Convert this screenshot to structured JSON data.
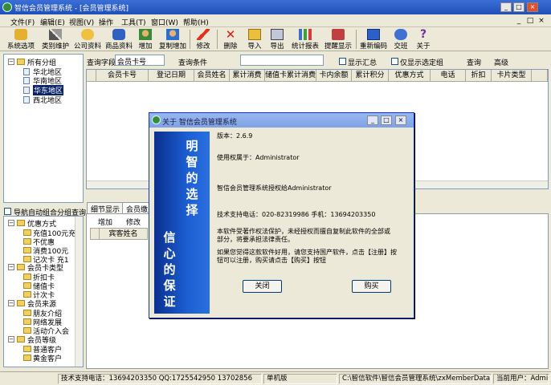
{
  "window": {
    "title": "智信会员管理系统 - [会员管理系统]",
    "min": "_",
    "max": "□",
    "close": "×"
  },
  "menu": [
    "文件(F)",
    "编辑(E)",
    "视图(V)",
    "操作",
    "工具(T)",
    "窗口(W)",
    "帮助(H)"
  ],
  "toolbar": [
    "系统选项",
    "类别维护",
    "公司资料",
    "商品资料",
    "增加",
    "复制增加",
    "修改",
    "删除",
    "导入",
    "导出",
    "统计报表",
    "提醒显示",
    "重新编码",
    "交班",
    "关于"
  ],
  "tree_groups": {
    "root": "所有分组",
    "items": [
      "华北地区",
      "华南地区",
      "华东地区",
      "西北地区"
    ]
  },
  "auto_query_label": "导航自动组合分组查询",
  "tree_nav": {
    "sections": [
      {
        "name": "优惠方式",
        "items": [
          "充值100元充",
          "不优惠",
          "消费100元",
          "记次卡 充1"
        ]
      },
      {
        "name": "会员卡类型",
        "items": [
          "折扣卡",
          "储值卡",
          "计次卡"
        ]
      },
      {
        "name": "会员来源",
        "items": [
          "朋友介绍",
          "网络发展",
          "活动介入会"
        ]
      },
      {
        "name": "会员等级",
        "items": [
          "普通客户",
          "黄金客户"
        ]
      }
    ]
  },
  "query": {
    "field_label": "查询字段",
    "field_value": "会员卡号",
    "cond_label": "查询条件",
    "show_summary": "显示汇总",
    "only_selected": "仅显示选定组",
    "query_btn": "查询",
    "advanced_btn": "高级"
  },
  "grid_columns": [
    "会员卡号",
    "登记日期",
    "会员姓名",
    "累计消费",
    "储值卡累计消费",
    "卡内余额",
    "累计积分",
    "优惠方式",
    "电话",
    "折扣",
    "卡片类型"
  ],
  "detail_tabs": [
    "细节显示",
    "会员缴费"
  ],
  "detail_toolbar": {
    "add": "增加",
    "edit": "修改"
  },
  "detail_column": "宾客姓名",
  "dialog": {
    "title": "关于 智信会员管理系统",
    "banner_top": [
      "明",
      "智",
      "的",
      "选",
      "择"
    ],
    "banner_bottom": [
      "信",
      "心",
      "的",
      "保",
      "证"
    ],
    "version": "版本：2.6.9",
    "user": "使用权属于：Administrator",
    "license": "智信会员管理系统授权给Administrator",
    "support": "技术支持电话：020-82319986 手机：13694203350",
    "notice1": "本软件受著作权法保护，未经授权而擅自复制此软件的全部或",
    "notice2": "部分，将要承担法律责任。",
    "notice3": "如果您觉得这款软件好用，请您支持国产软件，点击【注册】按",
    "notice4": "钮可以注册，购买请点击【购买】按钮",
    "close_btn": "关闭",
    "buy_btn": "购买"
  },
  "status": {
    "support": "技术支持电话：13694203350 QQ:1725542950 13702856",
    "edition": "单机版",
    "path": "C:\\智信软件\\智信会员管理系统\\zxMemberData.sys",
    "user": "当前用户：Admi"
  }
}
